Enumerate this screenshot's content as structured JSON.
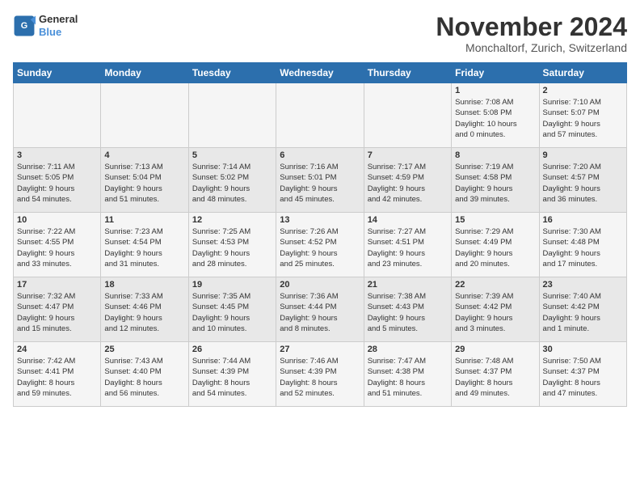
{
  "logo": {
    "line1": "General",
    "line2": "Blue"
  },
  "title": "November 2024",
  "subtitle": "Monchaltorf, Zurich, Switzerland",
  "weekdays": [
    "Sunday",
    "Monday",
    "Tuesday",
    "Wednesday",
    "Thursday",
    "Friday",
    "Saturday"
  ],
  "weeks": [
    [
      {
        "day": "",
        "info": ""
      },
      {
        "day": "",
        "info": ""
      },
      {
        "day": "",
        "info": ""
      },
      {
        "day": "",
        "info": ""
      },
      {
        "day": "",
        "info": ""
      },
      {
        "day": "1",
        "info": "Sunrise: 7:08 AM\nSunset: 5:08 PM\nDaylight: 10 hours\nand 0 minutes."
      },
      {
        "day": "2",
        "info": "Sunrise: 7:10 AM\nSunset: 5:07 PM\nDaylight: 9 hours\nand 57 minutes."
      }
    ],
    [
      {
        "day": "3",
        "info": "Sunrise: 7:11 AM\nSunset: 5:05 PM\nDaylight: 9 hours\nand 54 minutes."
      },
      {
        "day": "4",
        "info": "Sunrise: 7:13 AM\nSunset: 5:04 PM\nDaylight: 9 hours\nand 51 minutes."
      },
      {
        "day": "5",
        "info": "Sunrise: 7:14 AM\nSunset: 5:02 PM\nDaylight: 9 hours\nand 48 minutes."
      },
      {
        "day": "6",
        "info": "Sunrise: 7:16 AM\nSunset: 5:01 PM\nDaylight: 9 hours\nand 45 minutes."
      },
      {
        "day": "7",
        "info": "Sunrise: 7:17 AM\nSunset: 4:59 PM\nDaylight: 9 hours\nand 42 minutes."
      },
      {
        "day": "8",
        "info": "Sunrise: 7:19 AM\nSunset: 4:58 PM\nDaylight: 9 hours\nand 39 minutes."
      },
      {
        "day": "9",
        "info": "Sunrise: 7:20 AM\nSunset: 4:57 PM\nDaylight: 9 hours\nand 36 minutes."
      }
    ],
    [
      {
        "day": "10",
        "info": "Sunrise: 7:22 AM\nSunset: 4:55 PM\nDaylight: 9 hours\nand 33 minutes."
      },
      {
        "day": "11",
        "info": "Sunrise: 7:23 AM\nSunset: 4:54 PM\nDaylight: 9 hours\nand 31 minutes."
      },
      {
        "day": "12",
        "info": "Sunrise: 7:25 AM\nSunset: 4:53 PM\nDaylight: 9 hours\nand 28 minutes."
      },
      {
        "day": "13",
        "info": "Sunrise: 7:26 AM\nSunset: 4:52 PM\nDaylight: 9 hours\nand 25 minutes."
      },
      {
        "day": "14",
        "info": "Sunrise: 7:27 AM\nSunset: 4:51 PM\nDaylight: 9 hours\nand 23 minutes."
      },
      {
        "day": "15",
        "info": "Sunrise: 7:29 AM\nSunset: 4:49 PM\nDaylight: 9 hours\nand 20 minutes."
      },
      {
        "day": "16",
        "info": "Sunrise: 7:30 AM\nSunset: 4:48 PM\nDaylight: 9 hours\nand 17 minutes."
      }
    ],
    [
      {
        "day": "17",
        "info": "Sunrise: 7:32 AM\nSunset: 4:47 PM\nDaylight: 9 hours\nand 15 minutes."
      },
      {
        "day": "18",
        "info": "Sunrise: 7:33 AM\nSunset: 4:46 PM\nDaylight: 9 hours\nand 12 minutes."
      },
      {
        "day": "19",
        "info": "Sunrise: 7:35 AM\nSunset: 4:45 PM\nDaylight: 9 hours\nand 10 minutes."
      },
      {
        "day": "20",
        "info": "Sunrise: 7:36 AM\nSunset: 4:44 PM\nDaylight: 9 hours\nand 8 minutes."
      },
      {
        "day": "21",
        "info": "Sunrise: 7:38 AM\nSunset: 4:43 PM\nDaylight: 9 hours\nand 5 minutes."
      },
      {
        "day": "22",
        "info": "Sunrise: 7:39 AM\nSunset: 4:42 PM\nDaylight: 9 hours\nand 3 minutes."
      },
      {
        "day": "23",
        "info": "Sunrise: 7:40 AM\nSunset: 4:42 PM\nDaylight: 9 hours\nand 1 minute."
      }
    ],
    [
      {
        "day": "24",
        "info": "Sunrise: 7:42 AM\nSunset: 4:41 PM\nDaylight: 8 hours\nand 59 minutes."
      },
      {
        "day": "25",
        "info": "Sunrise: 7:43 AM\nSunset: 4:40 PM\nDaylight: 8 hours\nand 56 minutes."
      },
      {
        "day": "26",
        "info": "Sunrise: 7:44 AM\nSunset: 4:39 PM\nDaylight: 8 hours\nand 54 minutes."
      },
      {
        "day": "27",
        "info": "Sunrise: 7:46 AM\nSunset: 4:39 PM\nDaylight: 8 hours\nand 52 minutes."
      },
      {
        "day": "28",
        "info": "Sunrise: 7:47 AM\nSunset: 4:38 PM\nDaylight: 8 hours\nand 51 minutes."
      },
      {
        "day": "29",
        "info": "Sunrise: 7:48 AM\nSunset: 4:37 PM\nDaylight: 8 hours\nand 49 minutes."
      },
      {
        "day": "30",
        "info": "Sunrise: 7:50 AM\nSunset: 4:37 PM\nDaylight: 8 hours\nand 47 minutes."
      }
    ]
  ]
}
